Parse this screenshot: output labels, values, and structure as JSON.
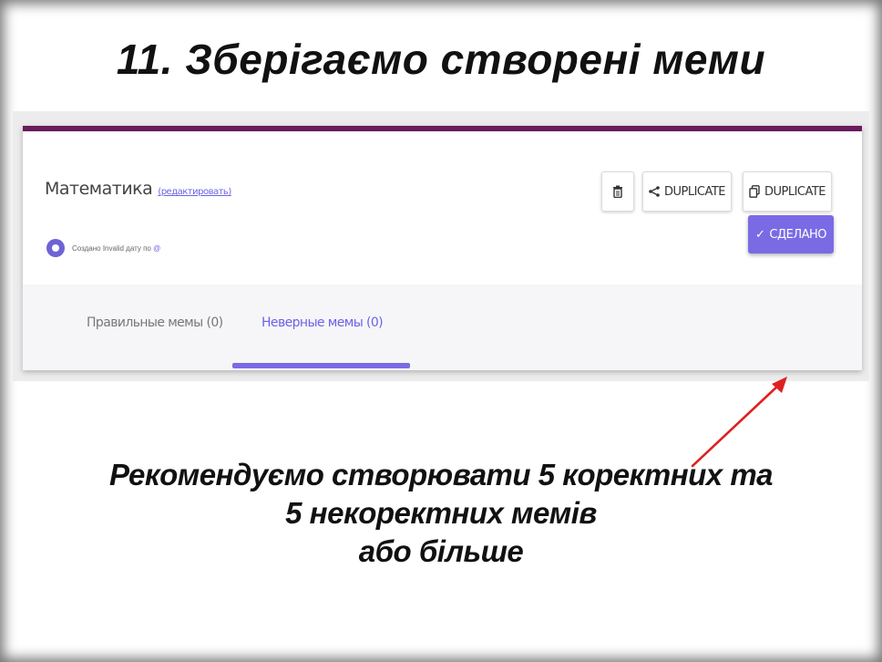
{
  "slide": {
    "title": "11. Зберігаємо створені меми",
    "note": {
      "line1": "Рекомендуємо створювати 5 коректних та",
      "line2": "5 некоректних мемів",
      "line3": "або більше"
    }
  },
  "quiz": {
    "title": "Математика",
    "edit_link": "(редактировать)",
    "author_prefix": "Создано Invalid дату по",
    "author_link": "@",
    "buttons": {
      "share_label": "DUPLICATE",
      "duplicate_label": "DUPLICATE",
      "done_label": "СДЕЛАНО"
    },
    "tabs": {
      "correct": "Правильные мемы (0)",
      "wrong": "Неверные мемы (0)"
    }
  },
  "colors": {
    "accent": "#7a6be5",
    "top_border": "#6a1b5b",
    "arrow": "#e02020"
  },
  "icons": {
    "delete": "trash-icon",
    "share": "share-icon",
    "duplicate": "copy-icon",
    "done": "check-icon"
  }
}
